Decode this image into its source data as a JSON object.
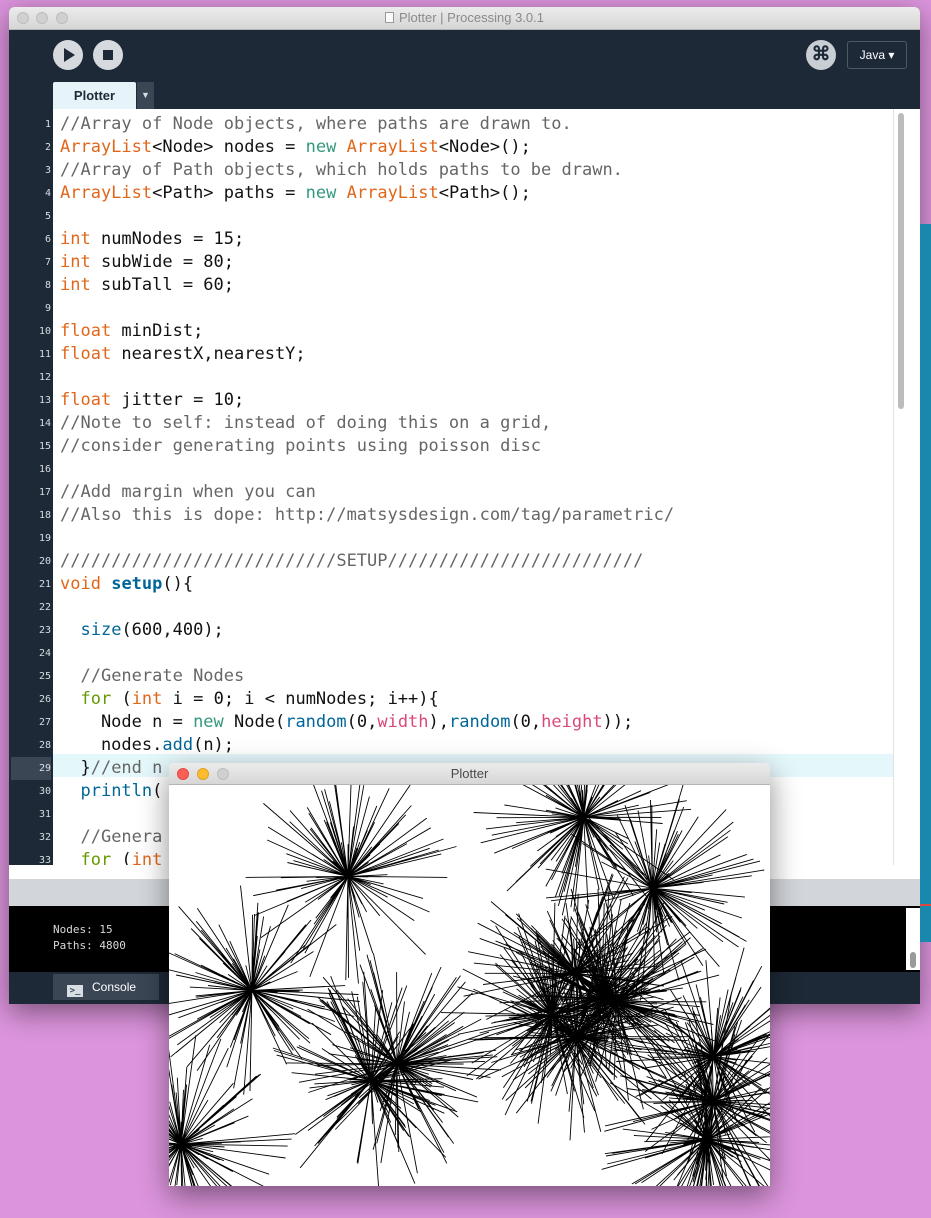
{
  "ide": {
    "title": "Plotter | Processing 3.0.1",
    "mode": "Java ▾",
    "debug_glyph": "⌘",
    "tab_label": "Plotter",
    "tab_menu_glyph": "▼",
    "highlighted_line": 29,
    "code": [
      {
        "n": "1",
        "h": "<span class='cm'>//Array of Node objects, where paths are drawn to.</span>"
      },
      {
        "n": "2",
        "h": "<span class='kw'>ArrayList</span>&lt;Node&gt; nodes = <span class='kw2'>new</span> <span class='kw'>ArrayList</span>&lt;Node&gt;();"
      },
      {
        "n": "3",
        "h": "<span class='cm'>//Array of Path objects, which holds paths to be drawn.</span>"
      },
      {
        "n": "4",
        "h": "<span class='kw'>ArrayList</span>&lt;Path&gt; paths = <span class='kw2'>new</span> <span class='kw'>ArrayList</span>&lt;Path&gt;();"
      },
      {
        "n": "5",
        "h": ""
      },
      {
        "n": "6",
        "h": "<span class='kw'>int</span> numNodes = 15;"
      },
      {
        "n": "7",
        "h": "<span class='kw'>int</span> subWide = 80;"
      },
      {
        "n": "8",
        "h": "<span class='kw'>int</span> subTall = 60;"
      },
      {
        "n": "9",
        "h": ""
      },
      {
        "n": "10",
        "h": "<span class='kw'>float</span> minDist;"
      },
      {
        "n": "11",
        "h": "<span class='kw'>float</span> nearestX,nearestY;"
      },
      {
        "n": "12",
        "h": ""
      },
      {
        "n": "13",
        "h": "<span class='kw'>float</span> jitter = 10;"
      },
      {
        "n": "14",
        "h": "<span class='cm'>//Note to self: instead of doing this on a grid,</span>"
      },
      {
        "n": "15",
        "h": "<span class='cm'>//consider generating points using poisson disc</span>"
      },
      {
        "n": "16",
        "h": ""
      },
      {
        "n": "17",
        "h": "<span class='cm'>//Add margin when you can</span>"
      },
      {
        "n": "18",
        "h": "<span class='cm'>//Also this is dope: http://matsysdesign.com/tag/parametric/</span>"
      },
      {
        "n": "19",
        "h": ""
      },
      {
        "n": "20",
        "h": "<span class='cm'>///////////////////////////SETUP/////////////////////////</span>"
      },
      {
        "n": "21",
        "h": "<span class='kw'>void</span> <span class='fnb'>setup</span>(){"
      },
      {
        "n": "22",
        "h": ""
      },
      {
        "n": "23",
        "h": "  <span class='fn'>size</span>(600,400);"
      },
      {
        "n": "24",
        "h": ""
      },
      {
        "n": "25",
        "h": "  <span class='cm'>//Generate Nodes</span>"
      },
      {
        "n": "26",
        "h": "  <span class='ctl'>for</span> (<span class='kw'>int</span> i = 0; i &lt; numNodes; i++){"
      },
      {
        "n": "27",
        "h": "    Node n = <span class='kw2'>new</span> Node(<span class='fn'>random</span>(0,<span class='ct'>width</span>),<span class='fn'>random</span>(0,<span class='ct'>height</span>));"
      },
      {
        "n": "28",
        "h": "    nodes.<span class='fn'>add</span>(n);"
      },
      {
        "n": "29",
        "h": "  }<span class='cm'>//end n</span>"
      },
      {
        "n": "30",
        "h": "  <span class='fn'>println</span>("
      },
      {
        "n": "31",
        "h": ""
      },
      {
        "n": "32",
        "h": "  <span class='cm'>//Genera</span>"
      },
      {
        "n": "33",
        "h": "  <span class='ctl'>for</span> (<span class='kw'>int</span>"
      }
    ],
    "console_lines": [
      "Nodes: 15",
      "Paths: 4800"
    ],
    "console_tab_label": "Console",
    "console_icon_glyph": ">_"
  },
  "sketch": {
    "title": "Plotter",
    "canvas_size": "600×400",
    "node_count": 15,
    "path_count": 4800,
    "stroke_color": "#000000",
    "background_color": "#ffffff"
  },
  "colors": {
    "desktop": "#dc94dc",
    "ide_chrome": "#1d2936",
    "keyword": "#e2661a",
    "comment": "#666666",
    "function": "#006699"
  }
}
